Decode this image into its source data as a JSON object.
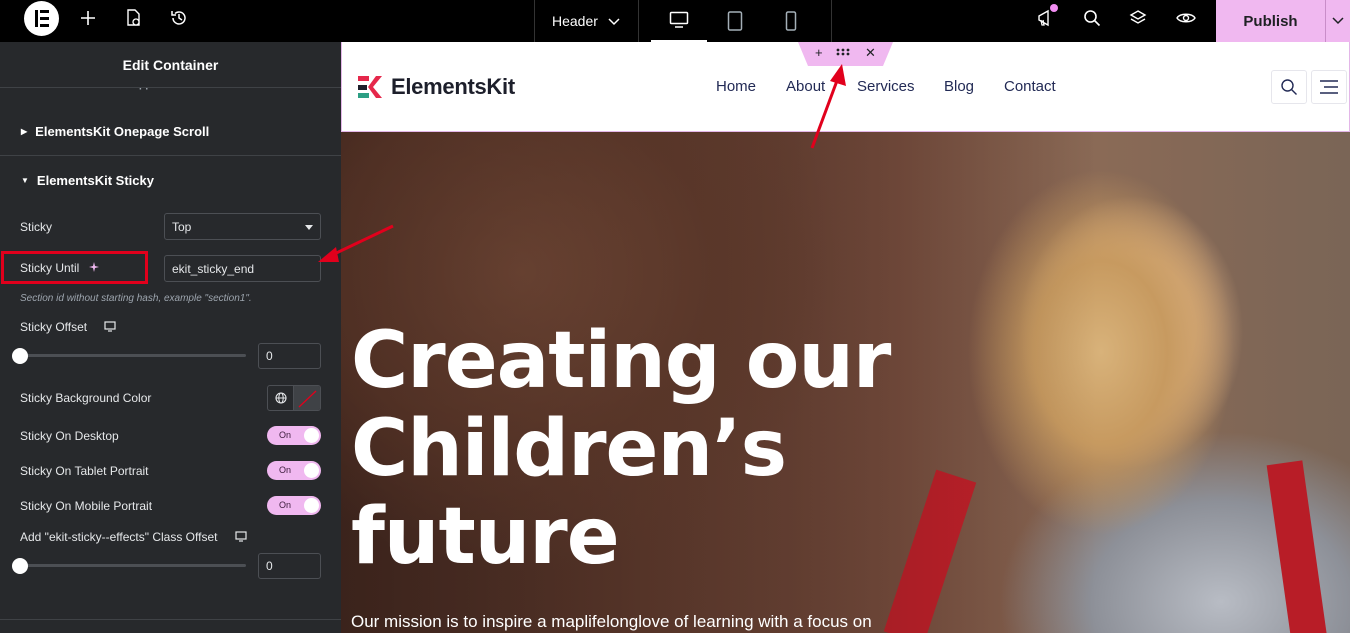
{
  "topbar": {
    "document_name": "Header",
    "publish_label": "Publish",
    "accent_color": "#f0b8f0"
  },
  "panel": {
    "title": "Edit Container",
    "sections": {
      "onepage_scroll": "ElementsKit Onepage Scroll",
      "sticky": "ElementsKit Sticky"
    },
    "sticky_label": "Sticky",
    "sticky_value": "Top",
    "sticky_until_label": "Sticky Until",
    "sticky_until_value": "ekit_sticky_end",
    "sticky_until_help": "Section id without starting hash, example \"section1\".",
    "sticky_offset_label": "Sticky Offset",
    "sticky_offset_value": "0",
    "bg_color_label": "Sticky Background Color",
    "on_desktop_label": "Sticky On Desktop",
    "on_tablet_label": "Sticky On Tablet Portrait",
    "on_mobile_label": "Sticky On Mobile Portrait",
    "toggle_on_text": "On",
    "effects_offset_label": "Add \"ekit-sticky--effects\" Class Offset",
    "effects_offset_value": "0"
  },
  "site": {
    "brand": "ElementsKit",
    "nav": [
      "Home",
      "About",
      "Services",
      "Blog",
      "Contact"
    ],
    "hero_title_lines": [
      "Creating our",
      "Children’s",
      "future"
    ],
    "hero_subtitle": "Our mission is to inspire a maplifelonglove of learning with a focus on",
    "nav_color": "#222a55"
  },
  "icons": {
    "app_logo": "elementor-logo-icon",
    "add": "plus-icon",
    "page_settings": "page-settings-icon",
    "history": "history-icon",
    "desktop": "desktop-icon",
    "tablet": "tablet-icon",
    "mobile": "mobile-icon",
    "announcements": "megaphone-icon",
    "search": "search-icon",
    "structure": "layers-icon",
    "preview": "eye-icon",
    "ai": "sparkle-icon",
    "responsive": "monitor-icon",
    "global": "globe-icon"
  }
}
